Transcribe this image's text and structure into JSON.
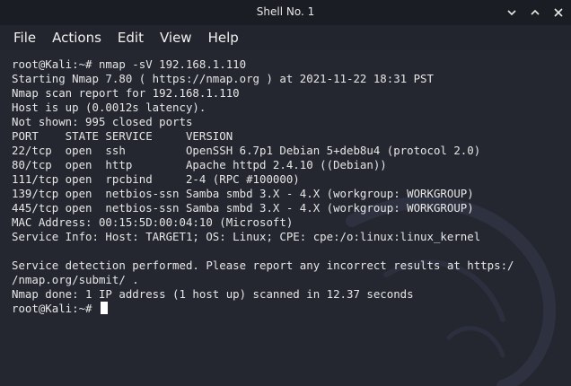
{
  "window": {
    "title": "Shell No. 1"
  },
  "menu": {
    "items": [
      "File",
      "Actions",
      "Edit",
      "View",
      "Help"
    ]
  },
  "icons": {
    "minimize": "chevron-down-icon",
    "maximize": "chevron-up-icon",
    "close": "close-icon"
  },
  "colors": {
    "background": "#242730",
    "text": "#e6e6e6",
    "titlebar": "#1b1d24"
  },
  "terminal": {
    "lines": [
      "root@Kali:~# nmap -sV 192.168.1.110",
      "Starting Nmap 7.80 ( https://nmap.org ) at 2021-11-22 18:31 PST",
      "Nmap scan report for 192.168.1.110",
      "Host is up (0.0012s latency).",
      "Not shown: 995 closed ports",
      "PORT    STATE SERVICE     VERSION",
      "22/tcp  open  ssh         OpenSSH 6.7p1 Debian 5+deb8u4 (protocol 2.0)",
      "80/tcp  open  http        Apache httpd 2.4.10 ((Debian))",
      "111/tcp open  rpcbind     2-4 (RPC #100000)",
      "139/tcp open  netbios-ssn Samba smbd 3.X - 4.X (workgroup: WORKGROUP)",
      "445/tcp open  netbios-ssn Samba smbd 3.X - 4.X (workgroup: WORKGROUP)",
      "MAC Address: 00:15:5D:00:04:10 (Microsoft)",
      "Service Info: Host: TARGET1; OS: Linux; CPE: cpe:/o:linux:linux_kernel",
      "",
      "Service detection performed. Please report any incorrect results at https:/",
      "/nmap.org/submit/ .",
      "Nmap done: 1 IP address (1 host up) scanned in 12.37 seconds"
    ],
    "prompt": "root@Kali:~# "
  }
}
